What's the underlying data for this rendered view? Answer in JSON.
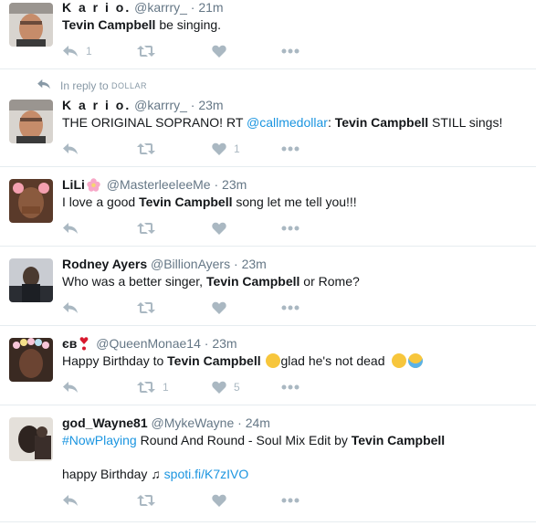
{
  "tweets": [
    {
      "name": "K a r i o.",
      "handle": "@karrry_",
      "sep": "·",
      "time": "21m",
      "text_before": "",
      "highlight": "Tevin Campbell",
      "text_after": " be singing.",
      "reply_count": "1",
      "retweet_count": "",
      "like_count": ""
    },
    {
      "reply_context_prefix": "In reply to",
      "reply_context_user": "DOLLAR",
      "name": "K a r i o.",
      "handle": "@karrry_",
      "sep": "·",
      "time": "23m",
      "text_before": "THE ORIGINAL SOPRANO! RT ",
      "mention": "@callmedollar",
      "text_mid": ": ",
      "highlight": "Tevin Campbell",
      "text_after": " STILL sings!",
      "reply_count": "",
      "retweet_count": "",
      "like_count": "1"
    },
    {
      "name": "LiLi",
      "handle": "@MasterleeleeMe",
      "sep": "·",
      "time": "23m",
      "text_before": "I love a good ",
      "highlight": "Tevin Campbell",
      "text_after": " song let me tell you!!!",
      "reply_count": "",
      "retweet_count": "",
      "like_count": ""
    },
    {
      "name": "Rodney Ayers",
      "handle": "@BillionAyers",
      "sep": "·",
      "time": "23m",
      "text_before": "Who was a better singer, ",
      "highlight": "Tevin Campbell",
      "text_after": " or Rome?",
      "reply_count": "",
      "retweet_count": "",
      "like_count": ""
    },
    {
      "name": "єв",
      "handle": "@QueenMonae14",
      "sep": "·",
      "time": "23m",
      "text_before": "Happy Birthday to ",
      "highlight": "Tevin Campbell",
      "text_after": "glad he's not dead",
      "reply_count": "",
      "retweet_count": "1",
      "like_count": "5"
    },
    {
      "name": "god_Wayne81",
      "handle": "@MykeWayne",
      "sep": "·",
      "time": "24m",
      "hashtag": "#NowPlaying",
      "text_before": " Round And Round - Soul Mix Edit by ",
      "highlight": "Tevin Campbell",
      "text_after": "",
      "line2_text": "happy Birthday ♫ ",
      "line2_link": "spoti.fi/K7zIVO",
      "reply_count": "",
      "retweet_count": "",
      "like_count": ""
    }
  ],
  "icons": {
    "reply": "reply-arrow-icon",
    "retweet": "retweet-icon",
    "like": "heart-icon",
    "more": "more-dots-icon"
  },
  "colors": {
    "icon": "#aab8c2",
    "link": "#1b95e0",
    "meta": "#657786",
    "divider": "#e6ecf0"
  }
}
